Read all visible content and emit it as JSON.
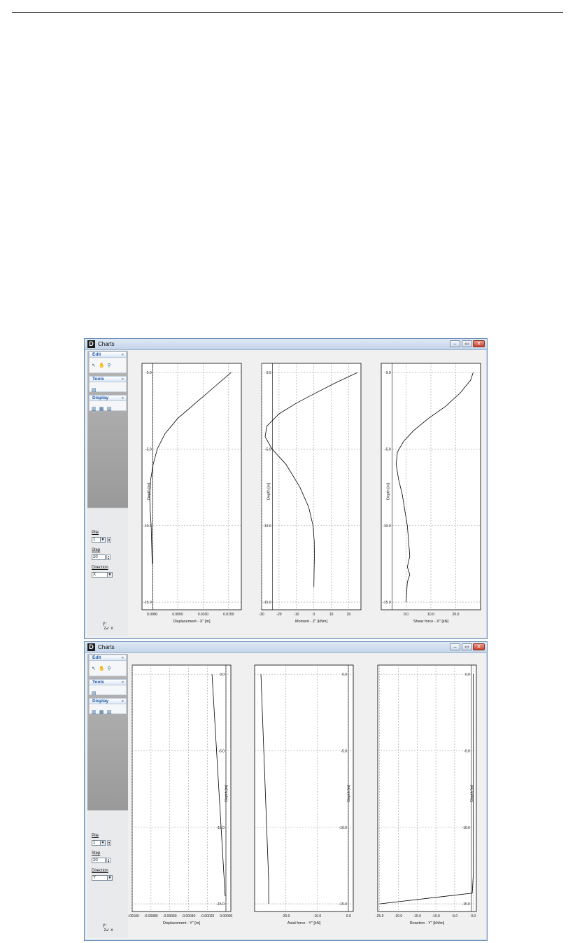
{
  "windows": [
    {
      "title": "Charts",
      "sidebar": {
        "edit": "Edit",
        "tools": "Tools",
        "display": "Display",
        "pile_label": "Pile",
        "pile_value": "1",
        "step_label": "Step",
        "step_value": "20",
        "direction_label": "Direction",
        "direction_value": "X"
      }
    },
    {
      "title": "Charts",
      "sidebar": {
        "edit": "Edit",
        "tools": "Tools",
        "display": "Display",
        "pile_label": "Pile",
        "pile_value": "1",
        "step_label": "Step",
        "step_value": "20",
        "direction_label": "Direction",
        "direction_value": "Y"
      }
    }
  ],
  "chart_data": [
    {
      "type": "line",
      "axis_side": "left",
      "xlabel": "Displacement - X\" [m]",
      "ylabel": "Depth [m]",
      "xlim": [
        -0.002,
        0.0175
      ],
      "ylim": [
        -15.5,
        0.6
      ],
      "xticks": [
        0.0,
        0.005,
        0.01,
        0.015
      ],
      "xtick_labels": [
        "0.0000",
        "0.0050",
        "0.0100",
        "0.0150"
      ],
      "yticks": [
        0.0,
        -5.0,
        -10.0,
        -15.0
      ],
      "ytick_labels": [
        "0.0",
        "-5.0",
        "-10.0",
        "-15.0"
      ],
      "x": [
        0.0155,
        0.012,
        0.0085,
        0.005,
        0.0025,
        0.001,
        0.0002,
        -0.0003,
        -0.0005,
        -0.0004,
        -0.0002,
        0.0
      ],
      "y": [
        0.0,
        -1.0,
        -2.0,
        -3.0,
        -4.0,
        -5.0,
        -6.0,
        -7.0,
        -8.0,
        -9.0,
        -10.0,
        -12.5
      ]
    },
    {
      "type": "line",
      "axis_side": "left",
      "xlabel": "Moment - Z\" [kNm]",
      "ylabel": "Depth [m]",
      "xlim": [
        -30,
        27
      ],
      "ylim": [
        -15.5,
        0.6
      ],
      "xticks": [
        -30,
        -20,
        -10,
        0,
        10,
        20
      ],
      "xtick_labels": [
        "-30",
        "-20",
        "-10",
        "0",
        "10",
        "20"
      ],
      "yticks": [
        0.0,
        -5.0,
        -10.0,
        -15.0
      ],
      "ytick_labels": [
        "0.0",
        "-5.0",
        "-10.0",
        "-15.0"
      ],
      "x": [
        25,
        12,
        0,
        -10,
        -20,
        -27,
        -28,
        -24,
        -16,
        -8,
        -3,
        -0.5,
        0.2,
        0.3,
        0.1,
        0.0
      ],
      "y": [
        0.0,
        -0.7,
        -1.4,
        -2.0,
        -2.7,
        -3.5,
        -4.2,
        -5.0,
        -6.0,
        -7.5,
        -8.8,
        -10.0,
        -11.0,
        -12.0,
        -13.0,
        -14.0
      ]
    },
    {
      "type": "line",
      "axis_side": "left",
      "xlabel": "Shear force - X\" [kN]",
      "ylabel": "Depth [m]",
      "xlim": [
        -10,
        30
      ],
      "ylim": [
        -15.5,
        0.6
      ],
      "xticks": [
        0.0,
        10.0,
        20.0
      ],
      "xtick_labels": [
        "0.0",
        "10.0",
        "20.0"
      ],
      "yticks": [
        0.0,
        -5.0,
        -10.0,
        -15.0
      ],
      "ytick_labels": [
        "0.0",
        "-5.0",
        "-10.0",
        "-15.0"
      ],
      "x": [
        27,
        26,
        22,
        16,
        9,
        3,
        -1,
        -3.5,
        -4,
        -3,
        -1.5,
        -0.5,
        0.5,
        1.0,
        1.5,
        0.5,
        1.5,
        0.5,
        0.0
      ],
      "y": [
        0.0,
        -0.5,
        -1.3,
        -2.2,
        -3.0,
        -3.8,
        -4.5,
        -5.2,
        -6.0,
        -7.0,
        -8.0,
        -9.0,
        -10.0,
        -11.0,
        -12.0,
        -12.7,
        -13.2,
        -13.7,
        -15.0
      ]
    },
    {
      "type": "line",
      "axis_side": "right",
      "xlabel": "Displacement - Y\" [m]",
      "ylabel": "Depth [m]",
      "xlim": [
        -0.001,
        5e-05
      ],
      "ylim": [
        -15.5,
        0.6
      ],
      "xticks": [
        -0.001,
        -0.0008,
        -0.0006,
        -0.0004,
        -0.0002,
        0.0
      ],
      "xtick_labels": [
        "-0.00100",
        "-0.00080",
        "-0.00060",
        "-0.00040",
        "-0.00020",
        "0.00000"
      ],
      "yticks": [
        0.0,
        -5.0,
        -10.0,
        -15.0
      ],
      "ytick_labels": [
        "0.0",
        "-5.0",
        "-10.0",
        "-15.0"
      ],
      "x": [
        -0.00015,
        -1e-05
      ],
      "y": [
        0.0,
        -14.5
      ]
    },
    {
      "type": "line",
      "axis_side": "right",
      "xlabel": "Axial force - Y\" [kN]",
      "ylabel": "Depth [m]",
      "xlim": [
        -30,
        1.5
      ],
      "ylim": [
        -15.5,
        0.6
      ],
      "xticks": [
        -20.0,
        -10.0,
        0.0
      ],
      "xtick_labels": [
        "-20.0",
        "-10.0",
        "0.0"
      ],
      "yticks": [
        0.0,
        -5.0,
        -10.0,
        -15.0
      ],
      "ytick_labels": [
        "0.0",
        "-5.0",
        "-10.0",
        "-15.0"
      ],
      "x": [
        -28,
        -25.5,
        -25.5
      ],
      "y": [
        0.0,
        -13.5,
        -15.0
      ]
    },
    {
      "type": "line",
      "axis_side": "right",
      "xlabel": "Reaction - Y\" [kN/m]",
      "ylabel": "Depth [m]",
      "xlim": [
        -25.5,
        0.8
      ],
      "ylim": [
        -15.5,
        0.6
      ],
      "xticks": [
        -25.0,
        -20.0,
        -15.0,
        -10.0,
        -5.0,
        0.0
      ],
      "xtick_labels": [
        "-25.0",
        "-20.0",
        "-15.0",
        "-10.0",
        "-5.0",
        "0.0"
      ],
      "yticks": [
        0.0,
        -5.0,
        -10.0,
        -15.0
      ],
      "ytick_labels": [
        "0.0",
        "-5.0",
        "-10.0",
        "-15.0"
      ],
      "x": [
        0.0,
        0.0,
        -0.3,
        -25.0
      ],
      "y": [
        0.0,
        -13.0,
        -14.3,
        -15.0
      ]
    }
  ]
}
